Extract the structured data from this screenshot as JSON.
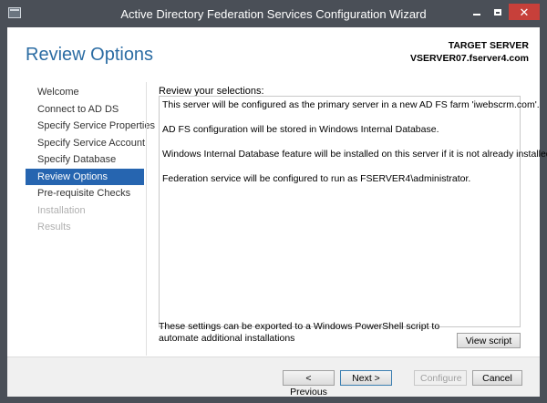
{
  "window": {
    "title": "Active Directory Federation Services Configuration Wizard",
    "icon": "server-manager-icon",
    "controls": [
      "minimize-icon",
      "maximize-icon",
      "close-icon"
    ]
  },
  "header": {
    "page_title": "Review Options",
    "target_label": "TARGET SERVER",
    "target_value": "VSERVER07.fserver4.com"
  },
  "nav": {
    "items": [
      {
        "label": "Welcome",
        "state": "normal"
      },
      {
        "label": "Connect to AD DS",
        "state": "normal"
      },
      {
        "label": "Specify Service Properties",
        "state": "normal"
      },
      {
        "label": "Specify Service Account",
        "state": "normal"
      },
      {
        "label": "Specify Database",
        "state": "normal"
      },
      {
        "label": "Review Options",
        "state": "active"
      },
      {
        "label": "Pre-requisite Checks",
        "state": "normal"
      },
      {
        "label": "Installation",
        "state": "disabled"
      },
      {
        "label": "Results",
        "state": "disabled"
      }
    ]
  },
  "review": {
    "label": "Review your selections:",
    "lines": [
      "This server will be configured as the primary server in a new AD FS farm 'iwebscrm.com'.",
      "AD FS configuration will be stored in Windows Internal Database.",
      "Windows Internal Database feature will be installed on this server if it is not already installed.",
      "Federation service will be configured to run as FSERVER4\\administrator."
    ]
  },
  "export": {
    "text": "These settings can be exported to a Windows PowerShell script to automate additional installations",
    "view_script_label": "View script"
  },
  "footer": {
    "previous_label": "< Previous",
    "next_label": "Next >",
    "configure_label": "Configure",
    "cancel_label": "Cancel"
  },
  "colors": {
    "titlebar": "#4a4f57",
    "accent": "#2665b0",
    "page_title": "#2b6ca3",
    "close_button": "#c7403a"
  }
}
